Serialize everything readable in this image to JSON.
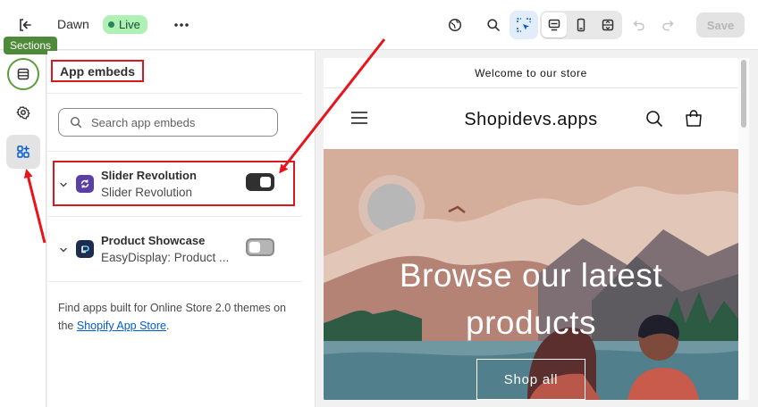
{
  "topbar": {
    "exit_icon": "exit-icon",
    "theme_name": "Dawn",
    "status_badge": "Live",
    "more_icon": "ellipsis-icon",
    "save_label": "Save",
    "tools": [
      "globe-icon",
      "search-icon",
      "inspector-icon",
      "desktop-icon",
      "mobile-icon",
      "fullscreen-icon",
      "undo-icon",
      "redo-icon"
    ]
  },
  "rail": {
    "tooltip": "Sections",
    "items": [
      "sections-icon",
      "settings-icon",
      "app-embeds-icon"
    ]
  },
  "panel": {
    "title": "App embeds",
    "search_placeholder": "Search app embeds",
    "embeds": [
      {
        "name": "Slider Revolution",
        "subtitle": "Slider Revolution",
        "enabled": true,
        "icon": "slider-revolution-icon",
        "icon_color": "#5b3fa7"
      },
      {
        "name": "Product Showcase",
        "subtitle": "EasyDisplay: Product ...",
        "enabled": false,
        "icon": "easydisplay-icon",
        "icon_color": "#1d2b4f"
      }
    ],
    "footer_text": "Find apps built for Online Store 2.0 themes on the",
    "footer_link": "Shopify App Store",
    "footer_end": "."
  },
  "preview": {
    "announcement": "Welcome to our store",
    "store_name": "Shopidevs.apps",
    "hero_line1": "Browse our latest",
    "hero_line2": "products",
    "hero_button": "Shop all"
  },
  "colors": {
    "accent": "#303030",
    "highlight_red": "#d7191f",
    "live_badge_bg": "#aff0b5",
    "tooltip_green": "#4f8a3a",
    "link_blue": "#005bd3"
  }
}
